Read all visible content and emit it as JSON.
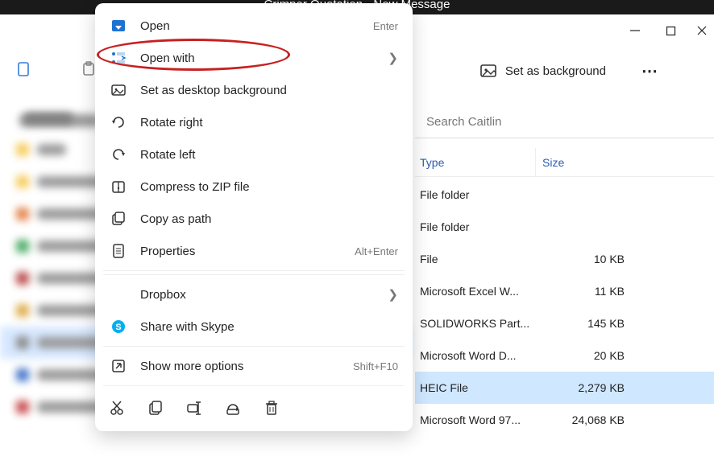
{
  "titlebar": {
    "text": "Crimper Quotation - New Message"
  },
  "toolbar": {
    "set_bg_label": "Set as background",
    "more_label": "⋯"
  },
  "search": {
    "placeholder": "Search Caitlin"
  },
  "columns": {
    "type": "Type",
    "size": "Size"
  },
  "rows": [
    {
      "type": "File folder",
      "size": ""
    },
    {
      "type": "File folder",
      "size": ""
    },
    {
      "type": "File",
      "size": "10 KB"
    },
    {
      "type": "Microsoft Excel W...",
      "size": "11 KB"
    },
    {
      "type": "SOLIDWORKS Part...",
      "size": "145 KB"
    },
    {
      "type": "Microsoft Word D...",
      "size": "20 KB"
    },
    {
      "type": "HEIC File",
      "size": "2,279 KB",
      "selected": true
    },
    {
      "type": "Microsoft Word 97...",
      "size": "24,068 KB"
    }
  ],
  "ctx": {
    "items": [
      {
        "id": "open",
        "label": "Open",
        "accel": "Enter"
      },
      {
        "id": "open-with",
        "label": "Open with",
        "chevron": true
      },
      {
        "id": "set-bg",
        "label": "Set as desktop background"
      },
      {
        "id": "rot-r",
        "label": "Rotate right"
      },
      {
        "id": "rot-l",
        "label": "Rotate left"
      },
      {
        "id": "zip",
        "label": "Compress to ZIP file"
      },
      {
        "id": "copypath",
        "label": "Copy as path"
      },
      {
        "id": "props",
        "label": "Properties",
        "accel": "Alt+Enter"
      },
      {
        "id": "dropbox",
        "label": "Dropbox",
        "chevron": true,
        "noicon": true
      },
      {
        "id": "skype",
        "label": "Share with Skype"
      },
      {
        "id": "more",
        "label": "Show more options",
        "accel": "Shift+F10"
      }
    ],
    "bottom_icons": [
      "cut",
      "copy",
      "rename",
      "share",
      "delete"
    ]
  }
}
